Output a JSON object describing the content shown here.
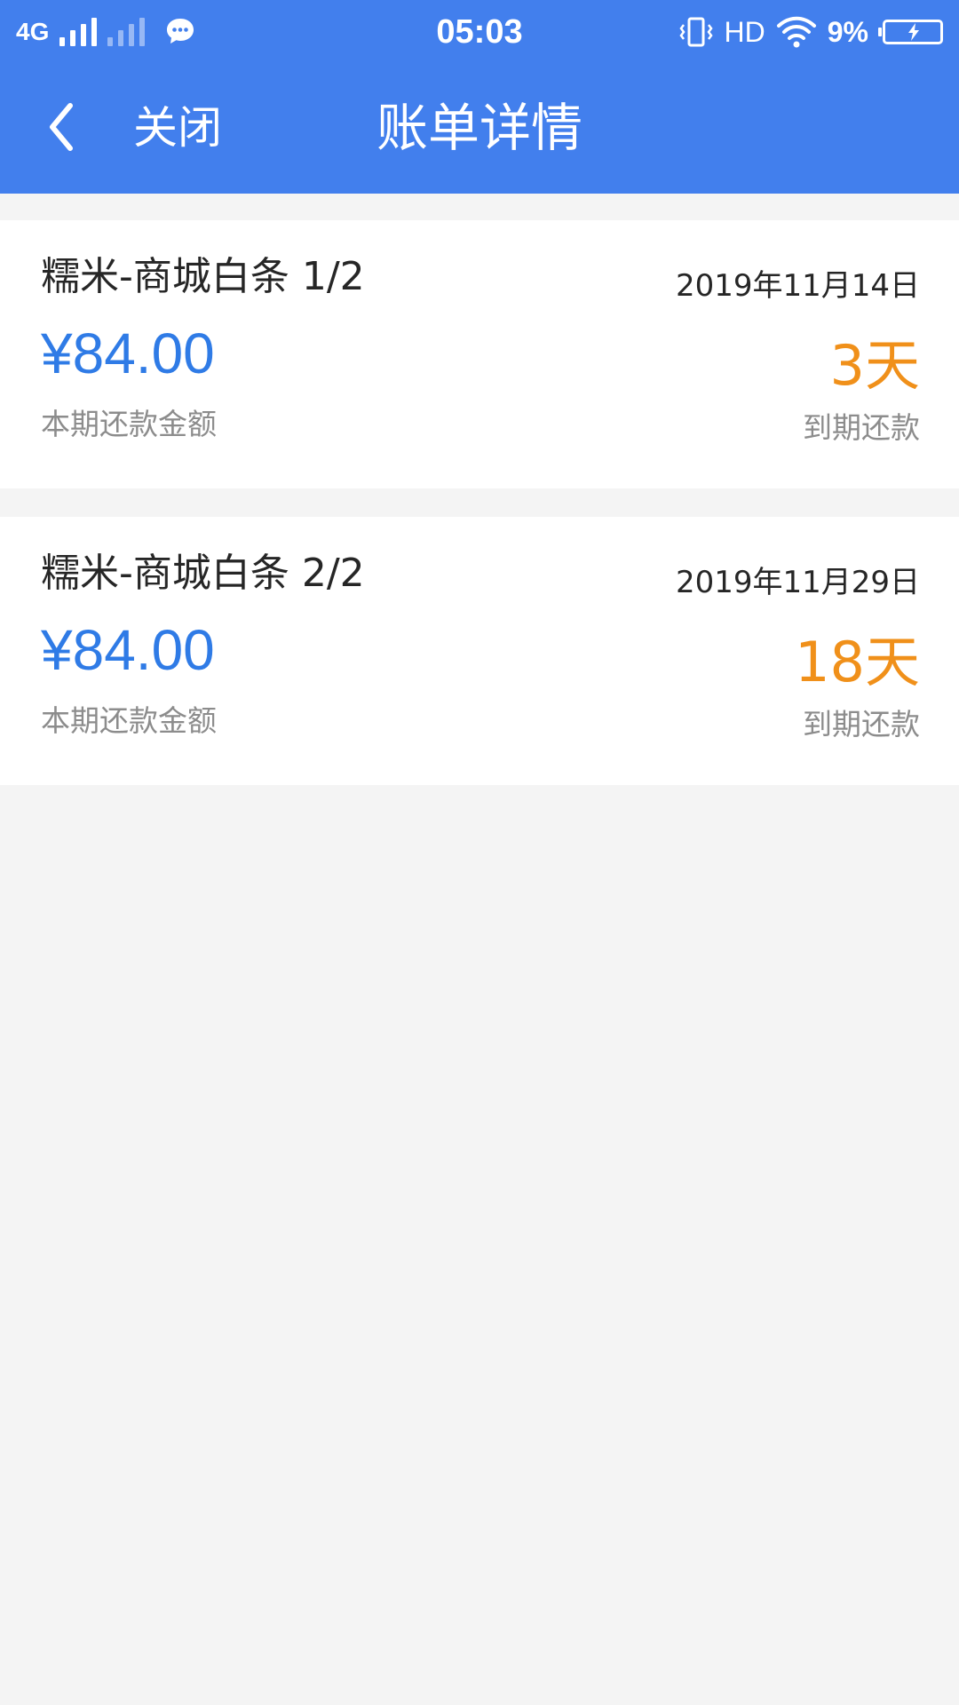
{
  "status_bar": {
    "network": "4G",
    "time": "05:03",
    "hd_label": "HD",
    "battery_percent": "9%",
    "icons": [
      "signal-icon",
      "chat-bubble-icon",
      "vibrate-icon",
      "wifi-icon",
      "battery-charging-icon"
    ]
  },
  "header": {
    "back_icon": "chevron-left-icon",
    "close_label": "关闭",
    "title": "账单详情"
  },
  "bills": [
    {
      "name": "糯米-商城白条 1/2",
      "amount": "¥84.00",
      "amount_label": "本期还款金额",
      "date": "2019年11月14日",
      "days": "3天",
      "days_label": "到期还款"
    },
    {
      "name": "糯米-商城白条 2/2",
      "amount": "¥84.00",
      "amount_label": "本期还款金额",
      "date": "2019年11月29日",
      "days": "18天",
      "days_label": "到期还款"
    }
  ],
  "colors": {
    "header_bg": "#427fed",
    "amount": "#2f7be6",
    "days": "#f0901a",
    "muted_text": "#8c8c8c",
    "page_bg": "#f4f4f4"
  }
}
